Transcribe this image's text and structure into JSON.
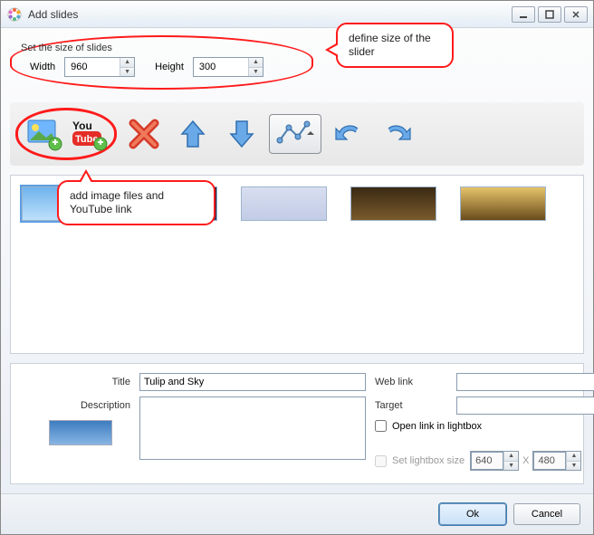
{
  "window": {
    "title": "Add slides"
  },
  "callouts": {
    "top": "define size of the slider",
    "mid": "add image files and YouTube link"
  },
  "size": {
    "legend": "Set the size of slides",
    "width_label": "Width",
    "width_value": "960",
    "height_label": "Height",
    "height_value": "300"
  },
  "toolbar": {
    "icons": {
      "add_image": "add-image-icon",
      "add_youtube": "add-youtube-icon",
      "delete": "delete-icon",
      "move_up": "arrow-up-icon",
      "move_down": "arrow-down-icon",
      "effects": "effects-icon",
      "undo": "undo-icon",
      "redo": "redo-icon"
    }
  },
  "thumbnails": [
    {
      "selected": true
    },
    {
      "selected": false
    },
    {
      "selected": false
    },
    {
      "selected": false
    },
    {
      "selected": false
    }
  ],
  "details": {
    "title_label": "Title",
    "title_value": "Tulip and Sky",
    "desc_label": "Description",
    "desc_value": "",
    "weblink_label": "Web link",
    "weblink_value": "",
    "target_label": "Target",
    "target_value": "",
    "open_lightbox_label": "Open link in lightbox",
    "open_lightbox_checked": false,
    "set_lightbox_label": "Set lightbox size",
    "set_lightbox_checked": false,
    "lightbox_w": "640",
    "lightbox_sep": "X",
    "lightbox_h": "480"
  },
  "footer": {
    "ok": "Ok",
    "cancel": "Cancel"
  }
}
